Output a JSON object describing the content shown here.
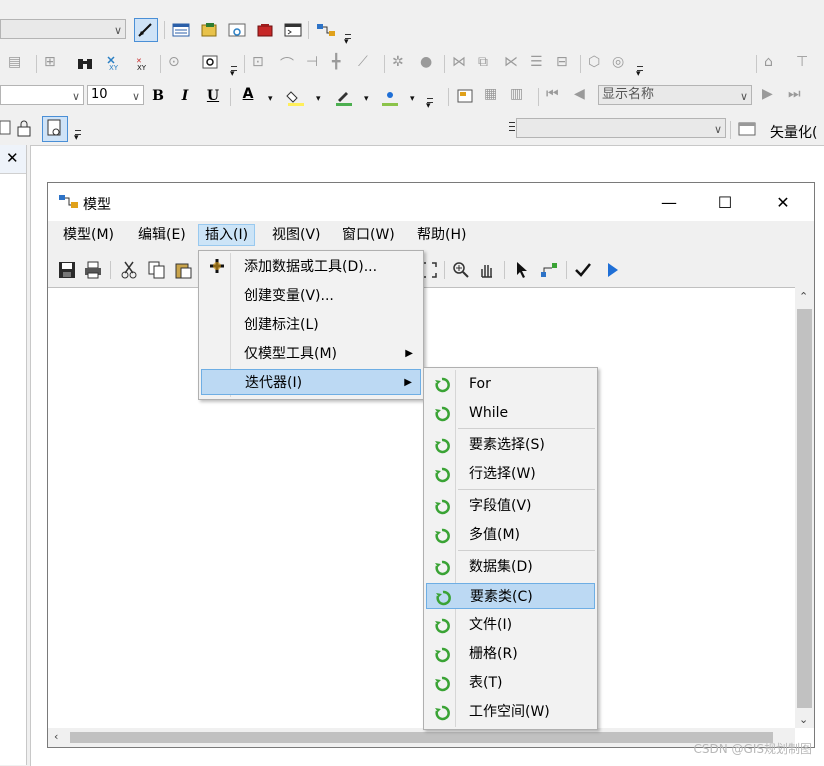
{
  "toolbar": {
    "font_size_value": "10",
    "label_field_value": "显示名称",
    "vectorize_label": "矢量化(",
    "bold_label": "B",
    "italic_label": "I",
    "underline_label": "U",
    "font_color_label": "A"
  },
  "model_window": {
    "title": "模型",
    "menubar": [
      {
        "label": "模型(M)"
      },
      {
        "label": "编辑(E)"
      },
      {
        "label": "插入(I)"
      },
      {
        "label": "视图(V)"
      },
      {
        "label": "窗口(W)"
      },
      {
        "label": "帮助(H)"
      }
    ]
  },
  "insert_menu": {
    "items": [
      {
        "label": "添加数据或工具(D)..."
      },
      {
        "label": "创建变量(V)..."
      },
      {
        "label": "创建标注(L)"
      },
      {
        "label": "仅模型工具(M)"
      },
      {
        "label": "迭代器(I)"
      }
    ]
  },
  "iterator_menu": {
    "items": [
      {
        "label": "For"
      },
      {
        "label": "While"
      },
      {
        "label": "要素选择(S)"
      },
      {
        "label": "行选择(W)"
      },
      {
        "label": "字段值(V)"
      },
      {
        "label": "多值(M)"
      },
      {
        "label": "数据集(D)"
      },
      {
        "label": "要素类(C)"
      },
      {
        "label": "文件(I)"
      },
      {
        "label": "栅格(R)"
      },
      {
        "label": "表(T)"
      },
      {
        "label": "工作空间(W)"
      }
    ]
  },
  "colors": {
    "highlight": "#bcd9f3",
    "iterator_icon": "#3aa335",
    "run_arrow": "#1f6fd6"
  }
}
